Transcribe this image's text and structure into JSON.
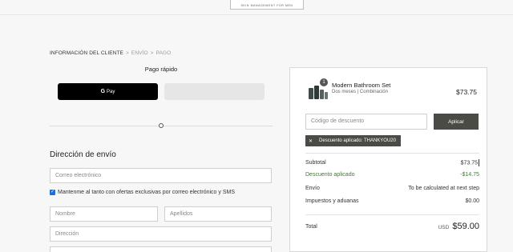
{
  "header": {
    "logo_tagline": "SKIN MANAGEMENT FOR MEN"
  },
  "breadcrumb": {
    "step1": "INFORMACIÓN DEL CLIENTE",
    "sep": ">",
    "step2": "ENVÍO",
    "step3": "PAGO"
  },
  "express": {
    "title": "Pago rápido",
    "gpay_label": "Pay",
    "gpay_icon": "google-g-icon"
  },
  "shipping": {
    "title": "Dirección de envío",
    "email_placeholder": "Correo electrónico",
    "marketing_label": "Mantenme al tanto con ofertas exclusivas por correo electrónico y SMS",
    "first_name_placeholder": "Nombre",
    "last_name_placeholder": "Apellidos",
    "address_placeholder": "Dirección"
  },
  "summary": {
    "product": {
      "name": "Modern Bathroom Set",
      "variant": "Dos meses | Combinación",
      "price": "$73.75",
      "quantity": "1"
    },
    "discount_placeholder": "Código de descuento",
    "apply_label": "Aplicar",
    "applied_tag": "Descuento aplicado: THANKYOU20",
    "subtotal_label": "Subtotal",
    "subtotal_value": "$73.75",
    "discount_label": "Descuento aplicado",
    "discount_value": "-$14.75",
    "shipping_label": "Envío",
    "shipping_value": "To be calculated at next step",
    "taxes_label": "Impuestos y aduanas",
    "taxes_value": "$0.00",
    "total_label": "Total",
    "total_currency": "USD",
    "total_value": "$59.00"
  },
  "colors": {
    "accent_dark": "#4b4b45",
    "discount_green": "#3a7d2c",
    "checkbox_blue": "#1a6fe0"
  }
}
